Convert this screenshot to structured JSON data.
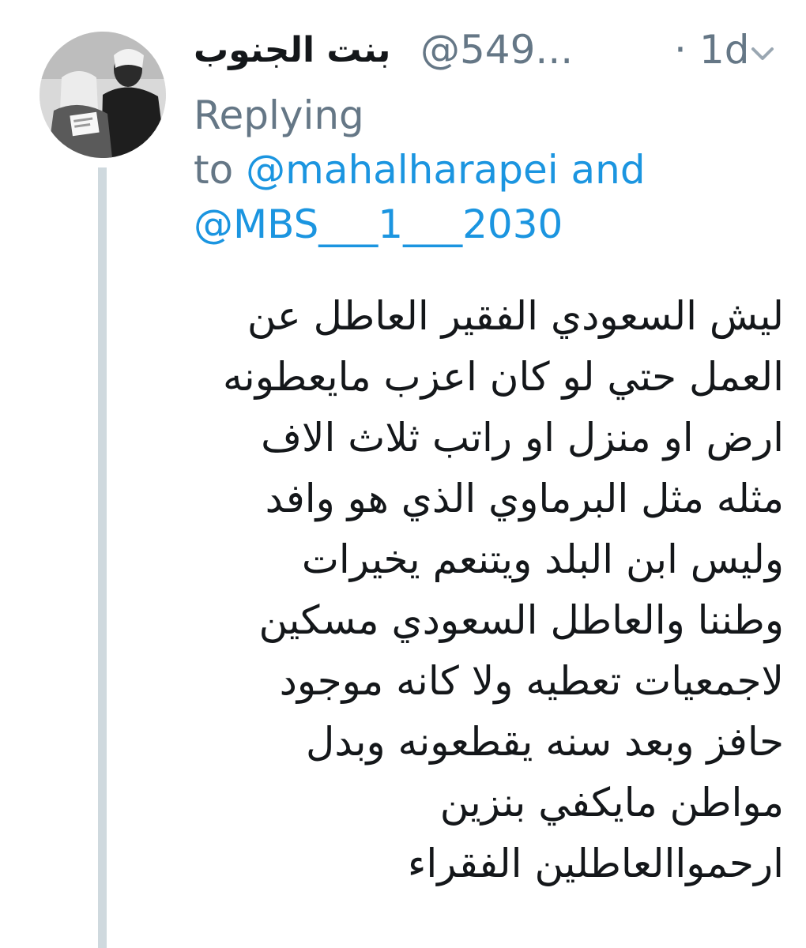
{
  "tweet": {
    "display_name": "بنت الجنوب",
    "handle": "@549...",
    "separator": "·",
    "time": "1d",
    "avatar_icon": "profile-photo",
    "menu_icon": "chevron-down-icon",
    "reply": {
      "prefix": "Replying",
      "to": "to",
      "mention_1": "@mahalharapei",
      "and": "and",
      "mention_2": "@MBS___1___2030"
    },
    "body_lines": [
      "ليش السعودي الفقير العاطل عن",
      "العمل حتي لو كان اعزب مايعطونه",
      "ارض او منزل او راتب ثلاث الاف",
      "مثله مثل البرماوي الذي هو وافد",
      "وليس ابن البلد ويتنعم يخيرات",
      "وطننا والعاطل السعودي مسكين",
      "لاجمعيات تعطيه ولا كانه موجود",
      "حافز وبعد سنه يقطعونه وبدل",
      "مواطن مايكفي بنزين",
      "ارحمواالعاطلين الفقراء"
    ]
  },
  "colors": {
    "text": "#14171a",
    "muted": "#657786",
    "link": "#1b95e0",
    "thread_line": "#cfd9de"
  }
}
